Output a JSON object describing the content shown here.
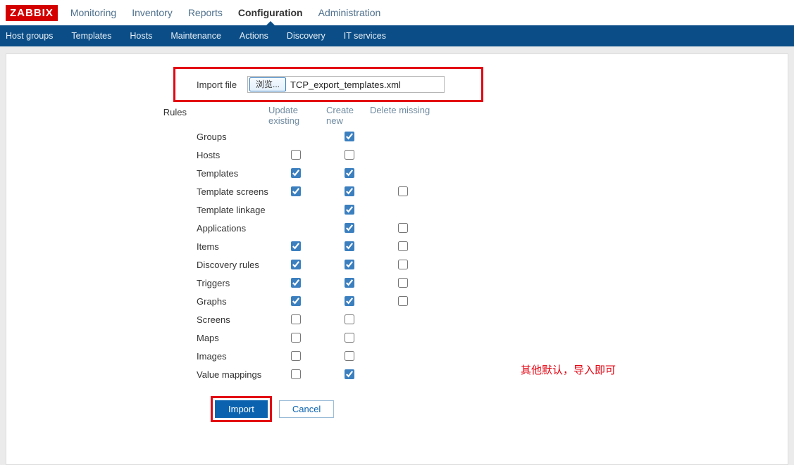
{
  "logo": "ZABBIX",
  "topnav": [
    "Monitoring",
    "Inventory",
    "Reports",
    "Configuration",
    "Administration"
  ],
  "topnav_active_index": 3,
  "subnav": [
    "Host groups",
    "Templates",
    "Hosts",
    "Maintenance",
    "Actions",
    "Discovery",
    "IT services"
  ],
  "form": {
    "import_file_label": "Import file",
    "browse_button": "浏览...",
    "filename": "TCP_export_templates.xml",
    "rules_label": "Rules",
    "columns": {
      "update_existing": "Update existing",
      "create_new": "Create new",
      "delete_missing": "Delete missing"
    },
    "rules": [
      {
        "name": "Groups",
        "ue": null,
        "cn": true,
        "dm": null
      },
      {
        "name": "Hosts",
        "ue": false,
        "cn": false,
        "dm": null
      },
      {
        "name": "Templates",
        "ue": true,
        "cn": true,
        "dm": null
      },
      {
        "name": "Template screens",
        "ue": true,
        "cn": true,
        "dm": false
      },
      {
        "name": "Template linkage",
        "ue": null,
        "cn": true,
        "dm": null
      },
      {
        "name": "Applications",
        "ue": null,
        "cn": true,
        "dm": false
      },
      {
        "name": "Items",
        "ue": true,
        "cn": true,
        "dm": false
      },
      {
        "name": "Discovery rules",
        "ue": true,
        "cn": true,
        "dm": false
      },
      {
        "name": "Triggers",
        "ue": true,
        "cn": true,
        "dm": false
      },
      {
        "name": "Graphs",
        "ue": true,
        "cn": true,
        "dm": false
      },
      {
        "name": "Screens",
        "ue": false,
        "cn": false,
        "dm": null
      },
      {
        "name": "Maps",
        "ue": false,
        "cn": false,
        "dm": null
      },
      {
        "name": "Images",
        "ue": false,
        "cn": false,
        "dm": null
      },
      {
        "name": "Value mappings",
        "ue": false,
        "cn": true,
        "dm": null
      }
    ],
    "import_button": "Import",
    "cancel_button": "Cancel"
  },
  "annotation": "其他默认，导入即可"
}
